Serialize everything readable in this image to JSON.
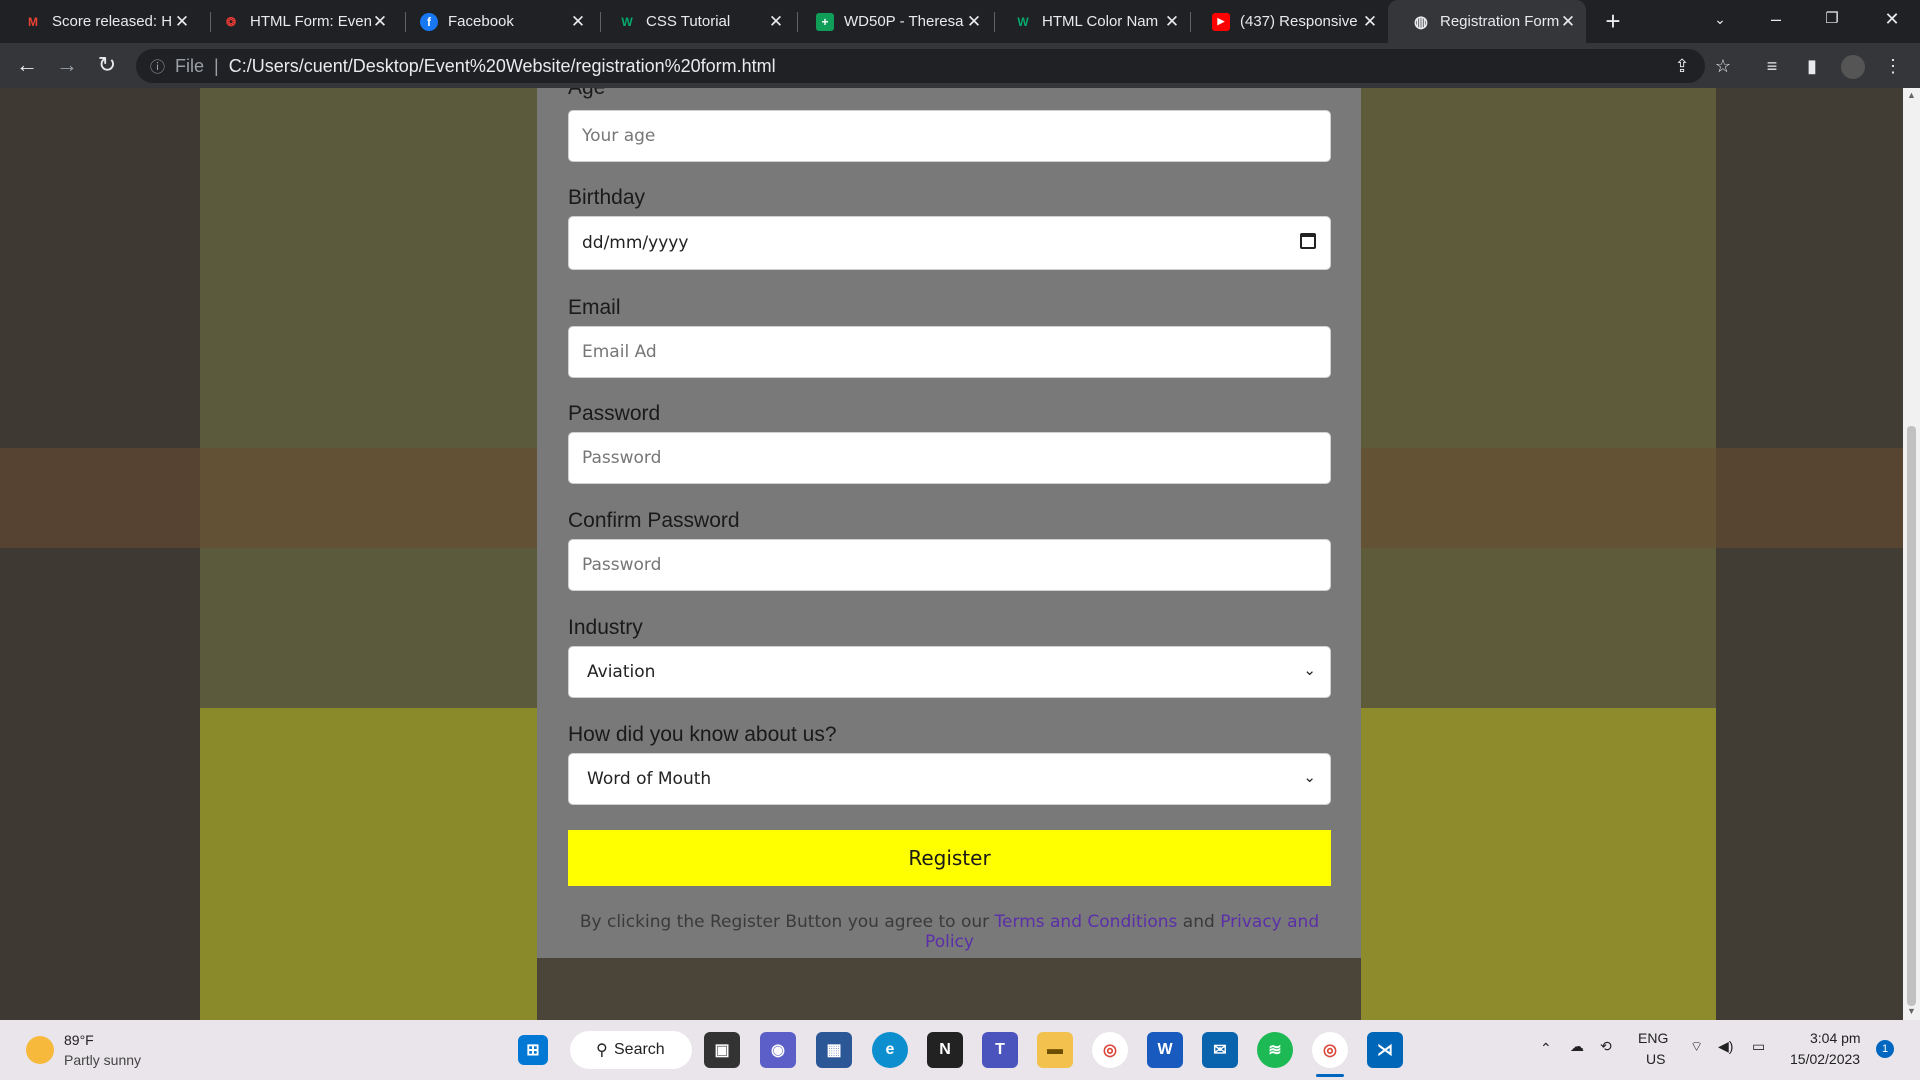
{
  "browser": {
    "tabs": [
      {
        "title": "Score released: H",
        "icon": "gmail-icon",
        "color": "#ea4335",
        "glyph": "M"
      },
      {
        "title": "HTML Form: Even",
        "icon": "event-icon",
        "color": "#e53935",
        "glyph": "❂"
      },
      {
        "title": "Facebook",
        "icon": "facebook-icon",
        "color": "#1877f2",
        "glyph": "f"
      },
      {
        "title": "CSS Tutorial",
        "icon": "w3schools-icon",
        "color": "#04aa6d",
        "glyph": "W"
      },
      {
        "title": "WD50P - Theresa",
        "icon": "sheets-icon",
        "color": "#0f9d58",
        "glyph": "+"
      },
      {
        "title": "HTML Color Nam",
        "icon": "w3schools-icon",
        "color": "#04aa6d",
        "glyph": "W"
      },
      {
        "title": "(437) Responsive",
        "icon": "youtube-icon",
        "color": "#ff0000",
        "glyph": "▶"
      },
      {
        "title": "Registration Form",
        "icon": "globe-icon",
        "color": "#e8eaed",
        "glyph": "◍"
      }
    ],
    "address": {
      "prefix": "File",
      "url": "C:/Users/cuent/Desktop/Event%20Website/registration%20form.html"
    }
  },
  "form": {
    "partial_label": "Age",
    "age_placeholder": "Your age",
    "birthday_label": "Birthday",
    "birthday_value": "dd/mm/yyyy",
    "email_label": "Email",
    "email_placeholder": "Email Ad",
    "password_label": "Password",
    "password_placeholder": "Password",
    "confirm_label": "Confirm Password",
    "confirm_placeholder": "Password",
    "industry_label": "Industry",
    "industry_value": "Aviation",
    "source_label": "How did you know about us?",
    "source_value": "Word of Mouth",
    "register_label": "Register",
    "terms_prefix": "By clicking the Register Button you agree to our",
    "terms_link": "Terms and Conditions",
    "terms_and": "and",
    "privacy_link": "Privacy and Policy"
  },
  "taskbar": {
    "weather_temp": "89°F",
    "weather_desc": "Partly sunny",
    "search_label": "Search",
    "lang_top": "ENG",
    "lang_bottom": "US",
    "time": "3:04 pm",
    "date": "15/02/2023",
    "notification_count": "1"
  }
}
